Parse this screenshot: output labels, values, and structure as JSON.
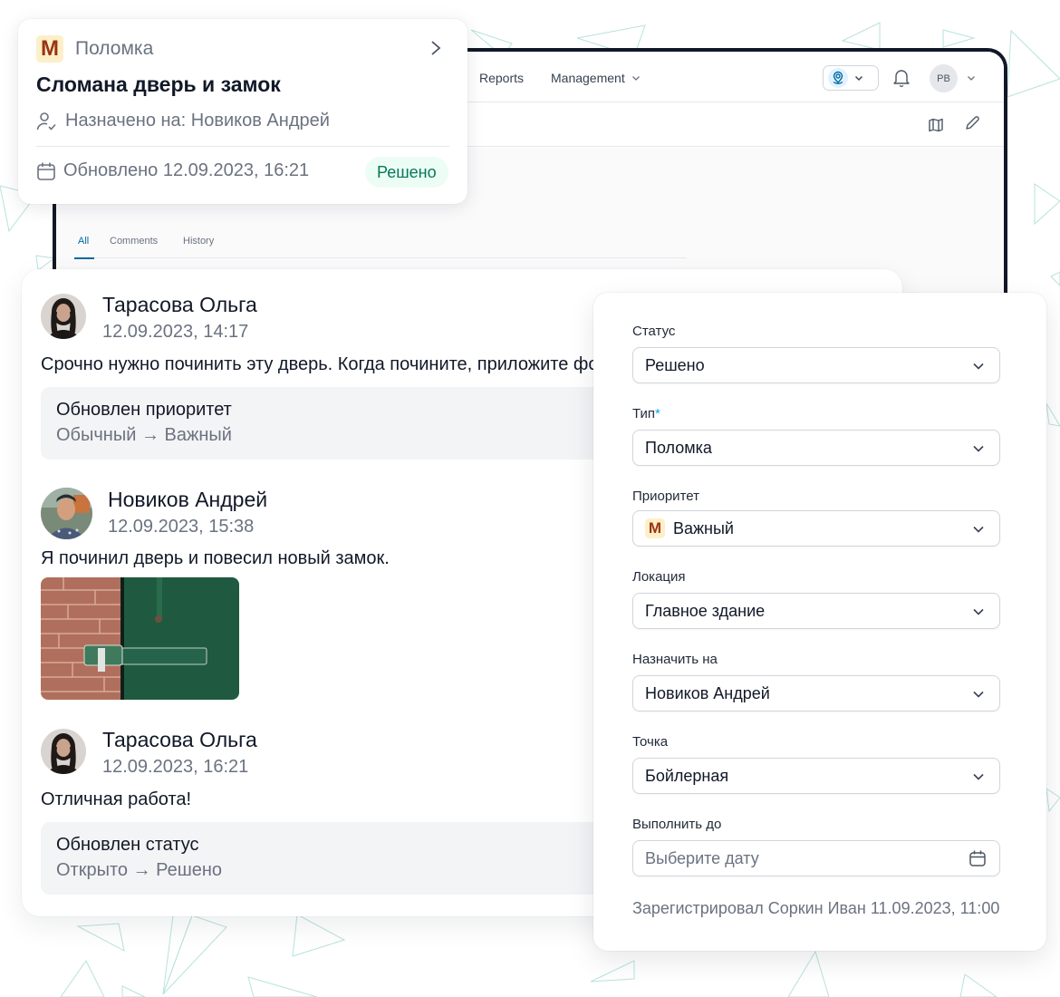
{
  "header": {
    "nav": {
      "reports": "Reports",
      "management": "Management"
    },
    "avatar_initials": "PB"
  },
  "tabs": {
    "all": "All",
    "comments": "Comments",
    "history": "History",
    "active": "All"
  },
  "ticket_card": {
    "priority_badge": "M",
    "type": "Поломка",
    "title": "Сломана дверь и замок",
    "assigned": "Назначено на: Новиков Андрей",
    "updated": "Обновлено 12.09.2023, 16:21",
    "status": "Решено"
  },
  "comments": [
    {
      "author": "Тарасова Ольга",
      "date": "12.09.2023, 14:17",
      "text": "Срочно нужно починить эту дверь. Когда почините, приложите фото",
      "history": {
        "title": "Обновлен приоритет",
        "change": "Обычный → Важный"
      }
    },
    {
      "author": "Новиков Андрей",
      "date": "12.09.2023, 15:38",
      "text": "Я починил дверь и повесил новый замок.",
      "attachment": "door-lock-photo"
    },
    {
      "author": "Тарасова Ольга",
      "date": "12.09.2023, 16:21",
      "text": "Отличная работа!",
      "history": {
        "title": "Обновлен статус",
        "change": "Открыто → Решено"
      }
    }
  ],
  "form": {
    "status": {
      "label": "Статус",
      "value": "Решено"
    },
    "type": {
      "label": "Тип",
      "required_mark": "*",
      "value": "Поломка"
    },
    "priority": {
      "label": "Приоритет",
      "badge": "M",
      "value": "Важный"
    },
    "location": {
      "label": "Локация",
      "value": "Главное здание"
    },
    "assignee": {
      "label": "Назначить на",
      "value": "Новиков Андрей"
    },
    "point": {
      "label": "Точка",
      "value": "Бойлерная"
    },
    "due": {
      "label": "Выполнить до",
      "placeholder": "Выберите дату"
    },
    "registered": "Зарегистрировал Соркин Иван 11.09.2023, 11:00"
  },
  "colors": {
    "accent": "#0369a1",
    "status_resolved_bg": "#ecfdf5",
    "status_resolved_fg": "#047857",
    "priority_badge_bg": "#fdefc7",
    "priority_badge_fg": "#9a3412",
    "frame": "#111827"
  }
}
